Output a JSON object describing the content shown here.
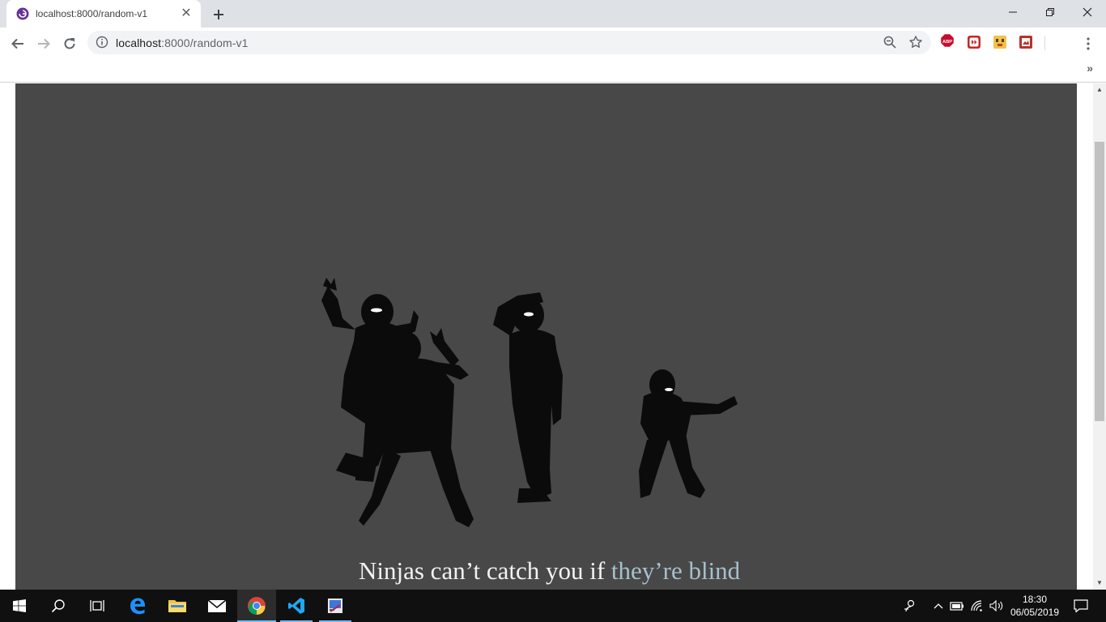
{
  "browser": {
    "tab": {
      "title": "localhost:8000/random-v1"
    },
    "address": {
      "host": "localhost",
      "rest": ":8000/random-v1"
    }
  },
  "page": {
    "caption": {
      "main": "Ninjas can’t catch you if ",
      "accent": "they’re blind"
    }
  },
  "taskbar": {
    "clock": {
      "time": "18:30",
      "date": "06/05/2019"
    }
  },
  "colors": {
    "stage_bg": "#484848",
    "caption_accent": "#a7c0cc",
    "taskbar_bg": "#101010",
    "tabstrip_bg": "#dee1e6"
  },
  "icons": [
    "chrome-icon",
    "close-icon",
    "plus-icon",
    "minimize-icon",
    "restore-icon",
    "back-icon",
    "forward-icon",
    "reload-icon",
    "info-icon",
    "zoom-icon",
    "star-icon",
    "adblock-icon",
    "menu-icon",
    "windows-icon",
    "search-icon",
    "edge-icon",
    "folder-icon",
    "mail-icon",
    "vscode-icon"
  ]
}
